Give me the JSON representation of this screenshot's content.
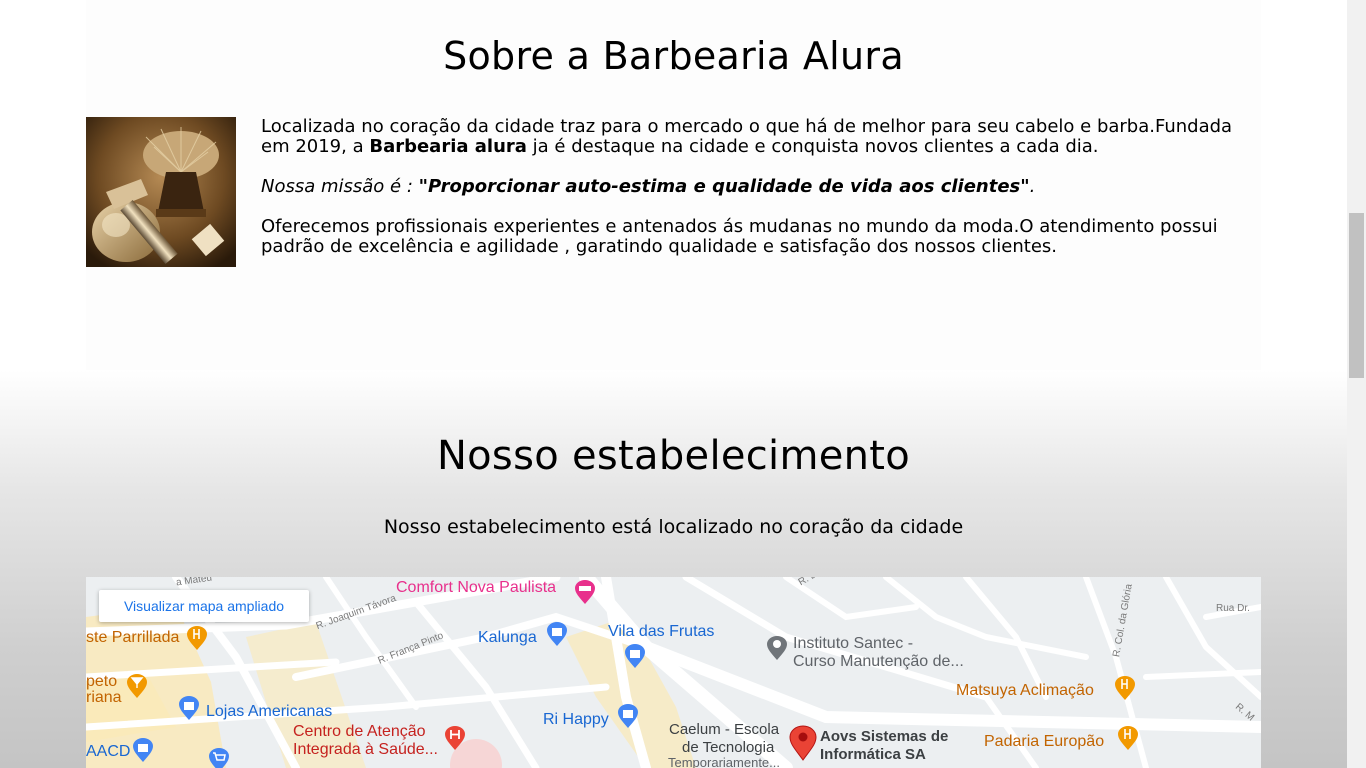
{
  "about": {
    "title": "Sobre a Barbearia Alura",
    "image_alt": "barber shaving brush and razor",
    "p1_before": "Localizada no coração da cidade traz para o mercado o que há de melhor para seu cabelo e barba.Fundada em 2019, a ",
    "p1_bold": "Barbearia alura",
    "p1_after": " ja é destaque na cidade e conquista novos clientes a cada dia.",
    "mission_label": "Nossa missão é : ",
    "mission_quote": "\"Proporcionar auto-estima e qualidade de vida aos clientes\"",
    "mission_end": ".",
    "p3": "Oferecemos profissionais experientes e antenados ás mudanas no mundo da moda.O atendimento possui padrão de excelência e agilidade , garatindo qualidade e satisfação dos nossos clientes."
  },
  "estabelecimento": {
    "title": "Nosso estabelecimento",
    "subtitle": "Nosso estabelecimento está localizado no coração da cidade"
  },
  "map": {
    "enlarge_label": "Visualizar mapa ampliado",
    "pois": {
      "comfort": "Comfort Nova Paulista",
      "parrilla": "ste Parrillada",
      "kalunga": "Kalunga",
      "vila": "Vila das Frutas",
      "santec1": "Instituto Santec -",
      "santec2": "Curso Manutenção de...",
      "matsuya": "Matsuya Aclimação",
      "espeto1": "petо",
      "espeto2": "riana",
      "lojas": "Lojas Americanas",
      "rihappy": "Ri Happy",
      "padaria": "Padaria Europão",
      "aacd": "AACD",
      "centro1": "Centro de Atenção",
      "centro2": "Integrada à Saúde...",
      "caelum1": "Caelum - Escola",
      "caelum2": "de Tecnologia",
      "caelum3": "Temporariamente...",
      "aovs1": "Aovs Sistemas de",
      "aovs2": "Informática SA"
    },
    "streets": {
      "tavora": "R. Joaquim Távora",
      "franca": "R. França Pinto",
      "gloria": "R. Col. da Glória",
      "rua_dr": "Rua Dr.",
      "mateus": "a Mateu",
      "rm": "R. M",
      "rd": "R. D"
    },
    "colors": {
      "food": "#f29900",
      "shop": "#4285f4",
      "health": "#ea4335",
      "place": "#70757a",
      "lodging": "#e8308c"
    }
  },
  "scrollbar": {
    "position_fraction": 0.28
  }
}
